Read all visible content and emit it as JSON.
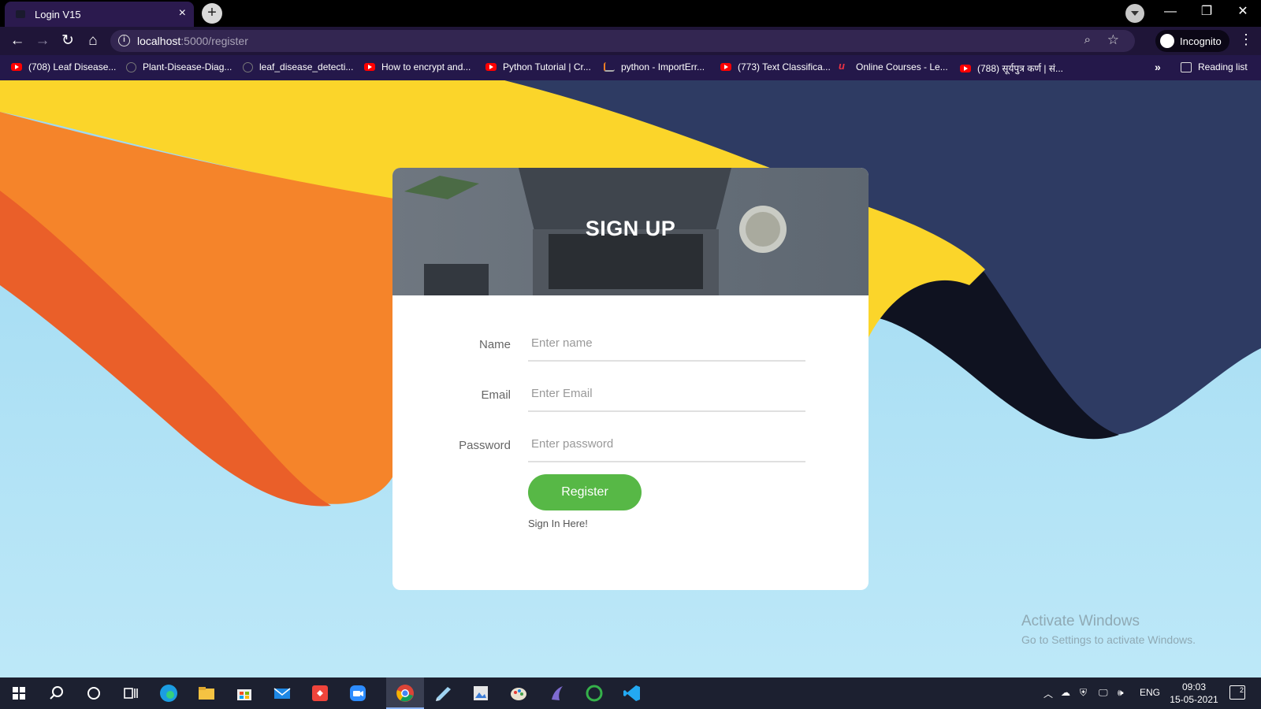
{
  "browser": {
    "tab_title": "Login V15",
    "tab_close": "×",
    "new_tab": "+",
    "url_host": "localhost",
    "url_path": ":5000/register",
    "incognito_label": "Incognito",
    "bookmarks": [
      {
        "icon": "youtube-icon",
        "label": "(708) Leaf Disease..."
      },
      {
        "icon": "github-icon",
        "label": "Plant-Disease-Diag..."
      },
      {
        "icon": "github-icon",
        "label": "leaf_disease_detecti..."
      },
      {
        "icon": "youtube-icon",
        "label": "How to encrypt and..."
      },
      {
        "icon": "youtube-icon",
        "label": "Python Tutorial | Cr..."
      },
      {
        "icon": "stackoverflow-icon",
        "label": "python - ImportErr..."
      },
      {
        "icon": "youtube-icon",
        "label": "(773) Text Classifica..."
      },
      {
        "icon": "udemy-icon",
        "label": "Online Courses - Le..."
      },
      {
        "icon": "youtube-icon",
        "label": "(788) सूर्यपुत्र कर्ण | सं..."
      }
    ],
    "bookmarks_more": "»",
    "reading_list": "Reading list"
  },
  "signup": {
    "title": "SIGN UP",
    "fields": [
      {
        "label": "Name",
        "placeholder": "Enter name"
      },
      {
        "label": "Email",
        "placeholder": "Enter Email"
      },
      {
        "label": "Password",
        "placeholder": "Enter password"
      }
    ],
    "register_label": "Register",
    "signin_link": "Sign In Here!"
  },
  "watermark": {
    "line1": "Activate Windows",
    "line2": "Go to Settings to activate Windows."
  },
  "taskbar": {
    "language": "ENG",
    "time": "09:03",
    "date": "15-05-2021",
    "notifications": "2"
  },
  "colors": {
    "accent_green": "#57b846",
    "chrome_purple": "#24184a"
  }
}
